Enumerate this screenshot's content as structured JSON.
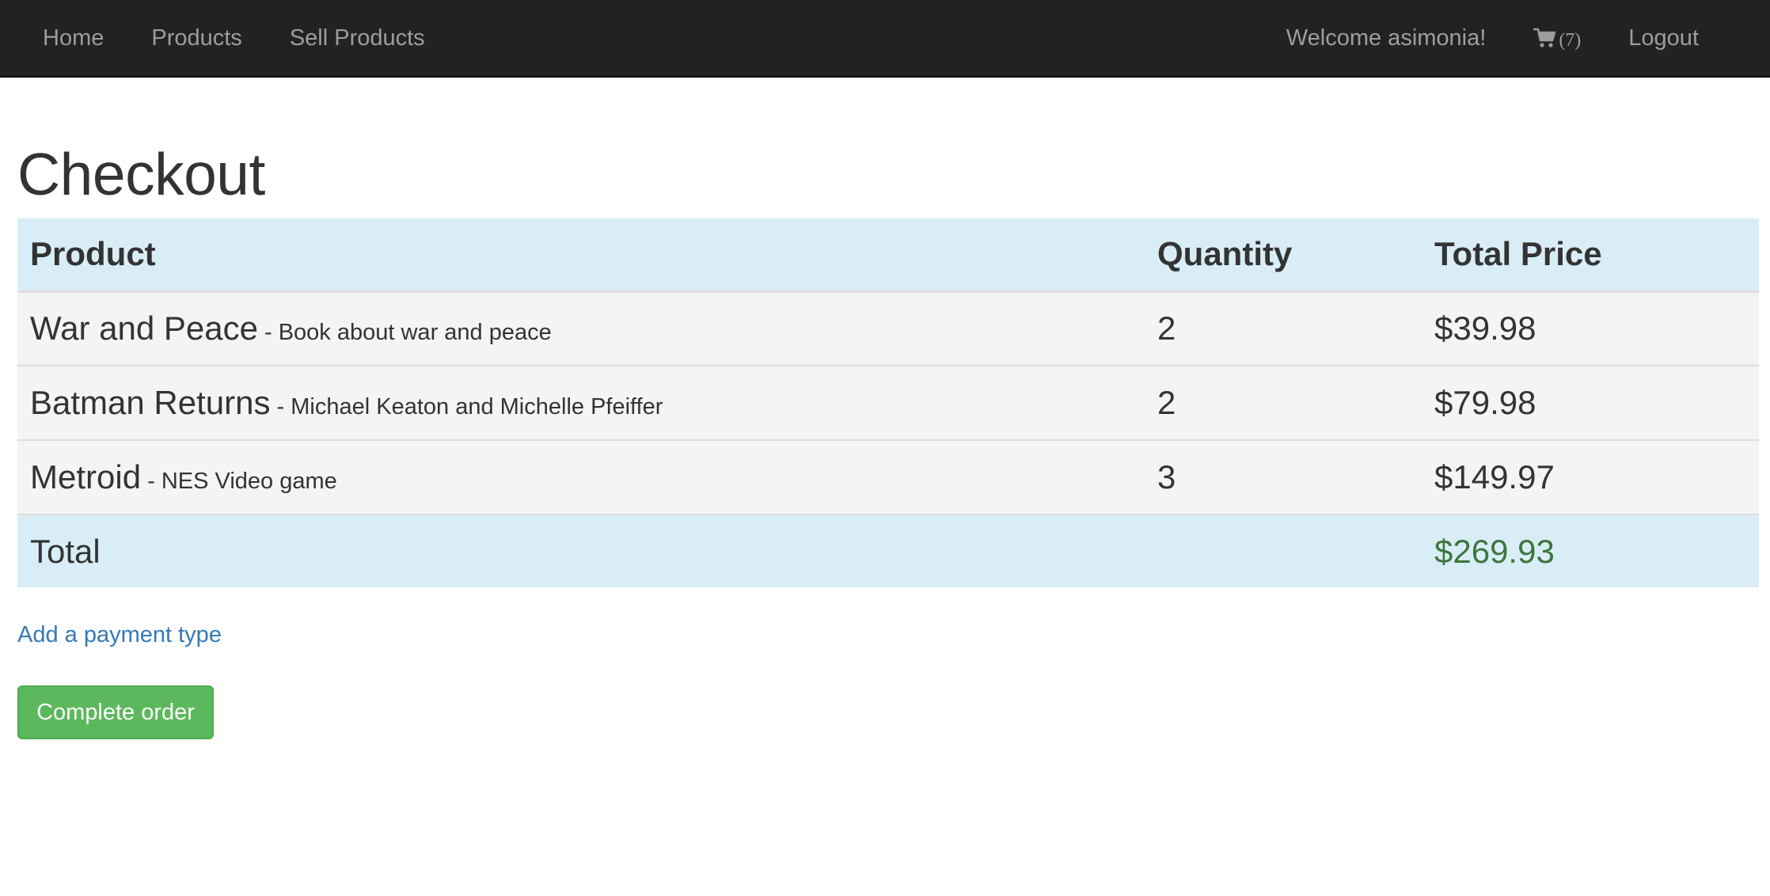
{
  "nav": {
    "home": "Home",
    "products": "Products",
    "sell_products": "Sell Products",
    "welcome": "Welcome asimonia!",
    "cart_icon": "shopping-cart-icon",
    "cart_count": "(7)",
    "logout": "Logout"
  },
  "page": {
    "title": "Checkout"
  },
  "table": {
    "headers": {
      "product": "Product",
      "quantity": "Quantity",
      "total_price": "Total Price"
    },
    "rows": [
      {
        "name": "War and Peace",
        "description": " - Book about war and peace",
        "quantity": "2",
        "price": "$39.98"
      },
      {
        "name": "Batman Returns",
        "description": " - Michael Keaton and Michelle Pfeiffer",
        "quantity": "2",
        "price": "$79.98"
      },
      {
        "name": "Metroid",
        "description": " - NES Video game",
        "quantity": "3",
        "price": "$149.97"
      }
    ],
    "total_label": "Total",
    "total_value": "$269.93"
  },
  "actions": {
    "add_payment": "Add a payment type",
    "complete_order": "Complete order"
  },
  "colors": {
    "navbar": "#222222",
    "table_header": "#d9edf7",
    "row_bg": "#f4f4f4",
    "link": "#337ab7",
    "success": "#5cb85c",
    "total_text": "#3c763d"
  }
}
